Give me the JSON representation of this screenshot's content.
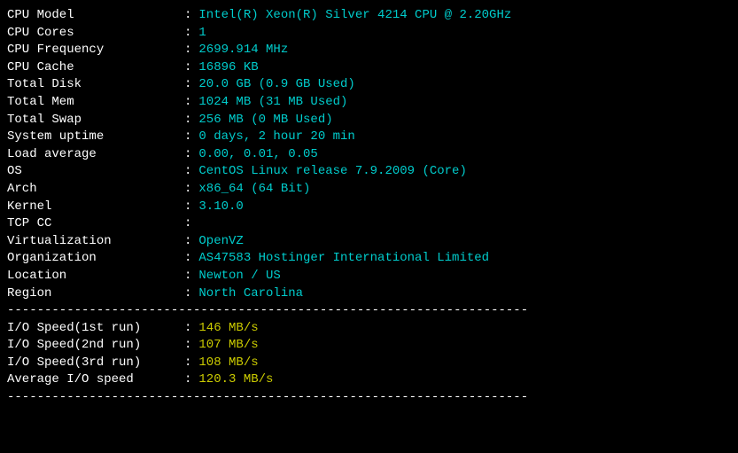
{
  "sys": {
    "cpu_model_label": "CPU Model            ",
    "cpu_model": "Intel(R) Xeon(R) Silver 4214 CPU @ 2.20GHz",
    "cpu_cores_label": "CPU Cores            ",
    "cpu_cores": "1",
    "cpu_freq_label": "CPU Frequency        ",
    "cpu_freq": "2699.914 MHz",
    "cpu_cache_label": "CPU Cache            ",
    "cpu_cache": "16896 KB",
    "total_disk_label": "Total Disk           ",
    "total_disk": "20.0 GB (0.9 GB Used)",
    "total_mem_label": "Total Mem            ",
    "total_mem": "1024 MB (31 MB Used)",
    "total_swap_label": "Total Swap           ",
    "total_swap": "256 MB (0 MB Used)",
    "uptime_label": "System uptime        ",
    "uptime": "0 days, 2 hour 20 min",
    "load_label": "Load average         ",
    "load": "0.00, 0.01, 0.05",
    "os_label": "OS                   ",
    "os": "CentOS Linux release 7.9.2009 (Core)",
    "arch_label": "Arch                 ",
    "arch": "x86_64 (64 Bit)",
    "kernel_label": "Kernel               ",
    "kernel": "3.10.0",
    "tcp_cc_label": "TCP CC               ",
    "tcp_cc": "",
    "virt_label": "Virtualization       ",
    "virt": "OpenVZ",
    "org_label": "Organization         ",
    "org": "AS47583 Hostinger International Limited",
    "loc_label": "Location             ",
    "loc": "Newton / US",
    "region_label": "Region               ",
    "region": "North Carolina"
  },
  "io": {
    "run1_label": "I/O Speed(1st run)   ",
    "run1": "146 MB/s",
    "run2_label": "I/O Speed(2nd run)   ",
    "run2": "107 MB/s",
    "run3_label": "I/O Speed(3rd run)   ",
    "run3": "108 MB/s",
    "avg_label": "Average I/O speed    ",
    "avg": "120.3 MB/s"
  },
  "divider": "----------------------------------------------------------------------",
  "colon": ":"
}
